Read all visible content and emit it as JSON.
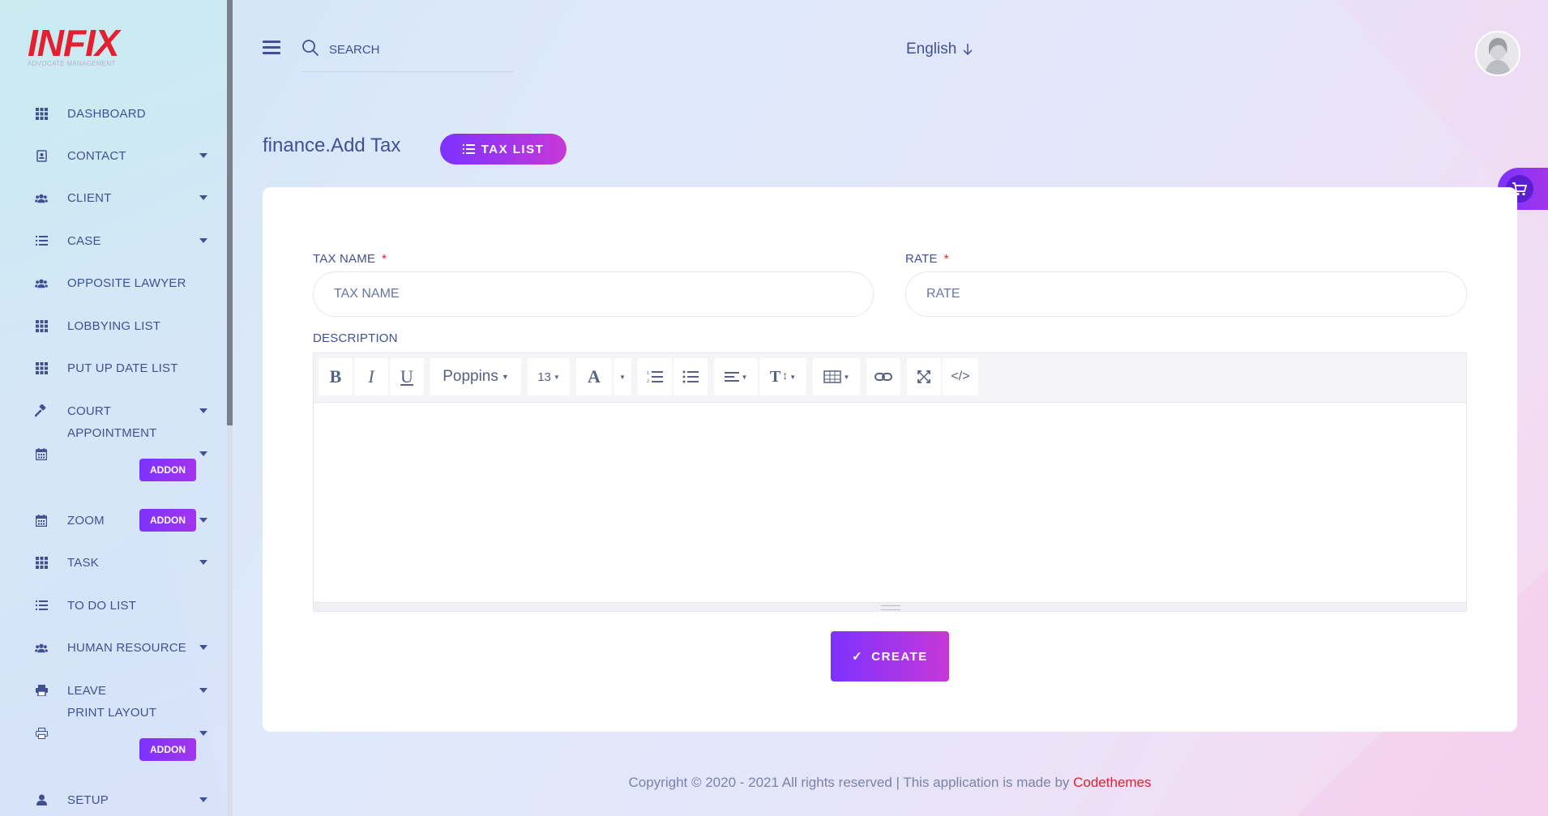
{
  "brand": {
    "logo_text": "INFIX",
    "tagline": "ADVOCATE MANAGEMENT"
  },
  "sidebar": {
    "items": [
      {
        "label": "DASHBOARD",
        "icon": "grid-icon",
        "caret": false
      },
      {
        "label": "CONTACT",
        "icon": "contact-card-icon",
        "caret": true
      },
      {
        "label": "CLIENT",
        "icon": "users-icon",
        "caret": true
      },
      {
        "label": "CASE",
        "icon": "list-icon",
        "caret": true
      },
      {
        "label": "OPPOSITE LAWYER",
        "icon": "users-icon",
        "caret": false
      },
      {
        "label": "LOBBYING LIST",
        "icon": "grid-icon",
        "caret": false
      },
      {
        "label": "PUT UP DATE LIST",
        "icon": "grid-icon",
        "caret": false
      },
      {
        "label": "COURT",
        "icon": "gavel-icon",
        "caret": true
      },
      {
        "label": "APPOINTMENT",
        "icon": "calendar-icon",
        "caret": true,
        "addon": "ADDON"
      },
      {
        "label": "ZOOM",
        "icon": "calendar-icon",
        "caret": true,
        "addon": "ADDON"
      },
      {
        "label": "TASK",
        "icon": "grid-icon",
        "caret": true
      },
      {
        "label": "TO DO LIST",
        "icon": "list-icon",
        "caret": false
      },
      {
        "label": "HUMAN RESOURCE",
        "icon": "users-icon",
        "caret": true
      },
      {
        "label": "LEAVE",
        "icon": "printer-icon",
        "caret": true
      },
      {
        "label": "PRINT LAYOUT",
        "icon": "print-outline-icon",
        "caret": true,
        "addon": "ADDON"
      },
      {
        "label": "SETUP",
        "icon": "user-icon",
        "caret": true
      }
    ]
  },
  "topbar": {
    "search_placeholder": "SEARCH",
    "language": "English"
  },
  "page": {
    "title": "finance.Add Tax",
    "tax_list_button": "TAX LIST"
  },
  "form": {
    "tax_name_label": "TAX NAME",
    "tax_name_placeholder": "TAX NAME",
    "rate_label": "RATE",
    "rate_placeholder": "RATE",
    "required_mark": "*",
    "description_label": "DESCRIPTION",
    "editor": {
      "font_family": "Poppins",
      "font_size": "13"
    },
    "create_button": "CREATE"
  },
  "footer": {
    "text": "Copyright © 2020 - 2021 All rights reserved | This application is made by ",
    "link": "Codethemes"
  },
  "colors": {
    "accent_start": "#7c32ff",
    "accent_end": "#c738d8",
    "text": "#415094",
    "brand_red": "#e2202f"
  }
}
